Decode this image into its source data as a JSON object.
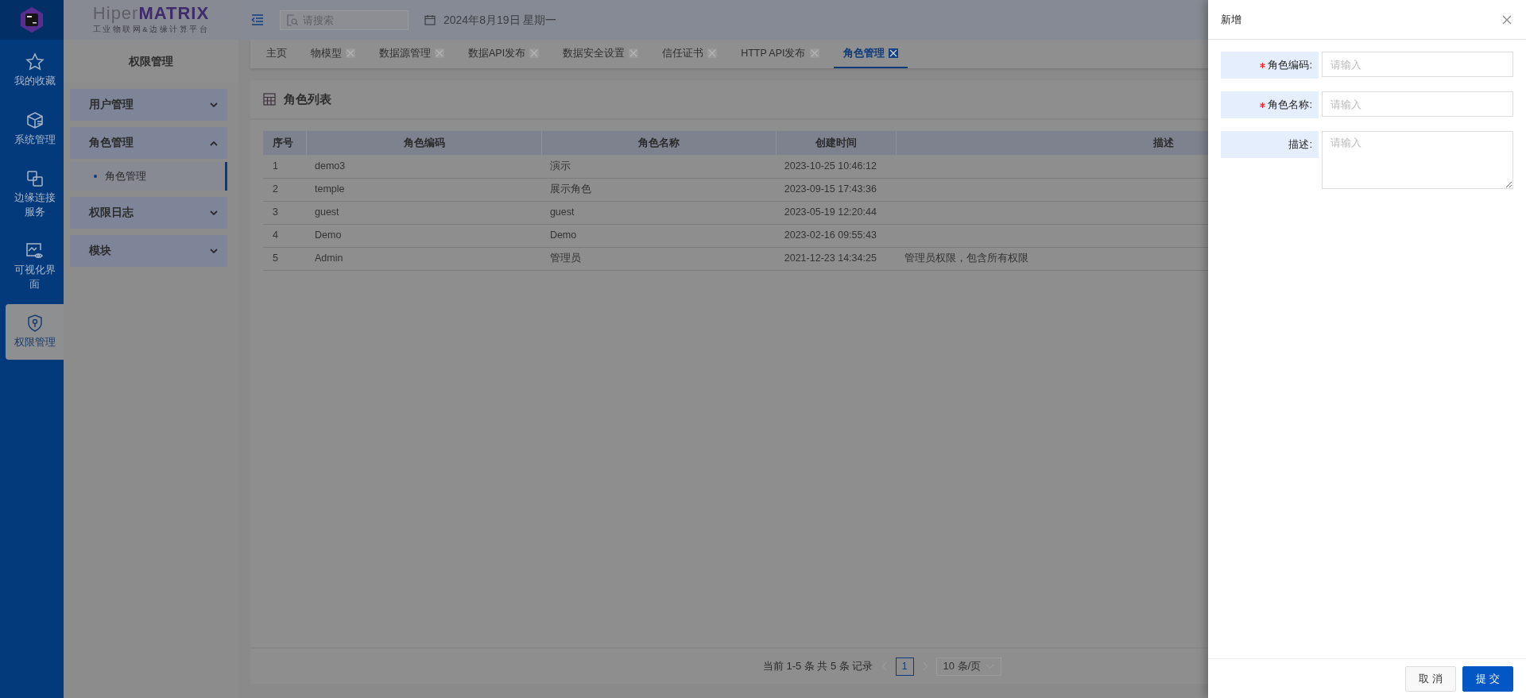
{
  "logo": {
    "brand_light": "Hiper",
    "brand_bold": "MATRIX",
    "tagline": "工业物联网&边缘计算平台"
  },
  "rail": [
    {
      "label": "我的收藏",
      "selected": false
    },
    {
      "label": "系统管理",
      "selected": false
    },
    {
      "label": "边缘连接服务",
      "selected": false
    },
    {
      "label": "可视化界面",
      "selected": false
    },
    {
      "label": "权限管理",
      "selected": true
    }
  ],
  "submenu": {
    "title": "权限管理",
    "groups": [
      {
        "label": "用户管理",
        "expanded": false
      },
      {
        "label": "角色管理",
        "expanded": true,
        "children": [
          {
            "label": "角色管理",
            "selected": true
          }
        ]
      },
      {
        "label": "权限日志",
        "expanded": false
      },
      {
        "label": "模块",
        "expanded": false
      }
    ]
  },
  "header": {
    "search": {
      "placeholder": "请搜索"
    },
    "date": "2024年8月19日 星期一"
  },
  "tabs": [
    {
      "label": "主页",
      "closable": false,
      "selected": false
    },
    {
      "label": "物模型",
      "closable": true,
      "selected": false
    },
    {
      "label": "数据源管理",
      "closable": true,
      "selected": false
    },
    {
      "label": "数据API发布",
      "closable": true,
      "selected": false
    },
    {
      "label": "数据安全设置",
      "closable": true,
      "selected": false
    },
    {
      "label": "信任证书",
      "closable": true,
      "selected": false
    },
    {
      "label": "HTTP API发布",
      "closable": true,
      "selected": false
    },
    {
      "label": "角色管理",
      "closable": true,
      "selected": true
    }
  ],
  "panel": {
    "title": "角色列表"
  },
  "table": {
    "columns": [
      "序号",
      "角色编码",
      "角色名称",
      "创建时间",
      "描述"
    ],
    "rows": [
      [
        "1",
        "demo3",
        "演示",
        "2023-10-25 10:46:12",
        ""
      ],
      [
        "2",
        "temple",
        "展示角色",
        "2023-09-15 17:43:36",
        ""
      ],
      [
        "3",
        "guest",
        "guest",
        "2023-05-19 12:20:44",
        ""
      ],
      [
        "4",
        "Demo",
        "Demo",
        "2023-02-16 09:55:43",
        ""
      ],
      [
        "5",
        "Admin",
        "管理员",
        "2021-12-23 14:34:25",
        "管理员权限，包含所有权限"
      ]
    ]
  },
  "pagination": {
    "summary": "当前 1-5 条 共 5 条 记录",
    "pages": [
      {
        "label": "1",
        "selected": true
      }
    ],
    "page_size": "10 条/页"
  },
  "drawer": {
    "title": "新增",
    "fields": [
      {
        "label": "角色编码:",
        "required": true,
        "kind": "input",
        "placeholder": "请输入"
      },
      {
        "label": "角色名称:",
        "required": true,
        "kind": "input",
        "placeholder": "请输入"
      },
      {
        "label": "描述:",
        "required": false,
        "kind": "textarea",
        "placeholder": "请输入"
      }
    ],
    "buttons": [
      {
        "label": "取 消",
        "kind": "secondary"
      },
      {
        "label": "提 交",
        "kind": "primary"
      }
    ]
  }
}
